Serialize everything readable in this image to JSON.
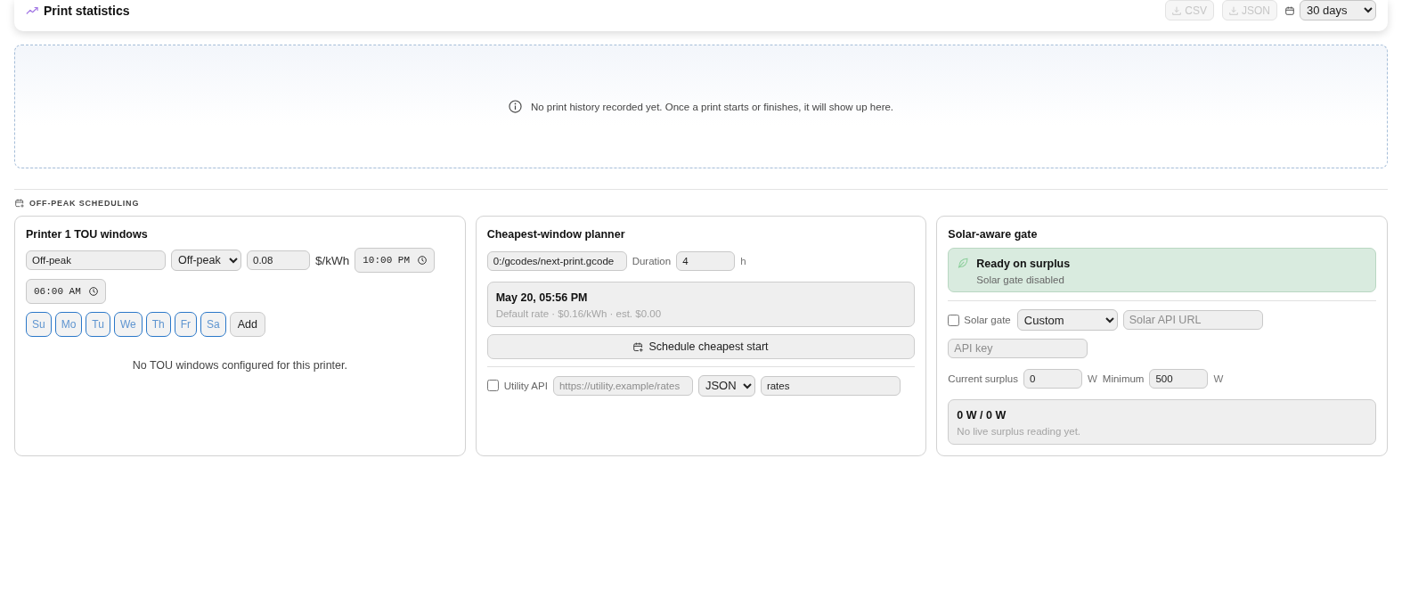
{
  "stats": {
    "title": "Print statistics",
    "exports": [
      {
        "label": "CSV",
        "disabled": true
      },
      {
        "label": "JSON",
        "disabled": true
      }
    ],
    "range": "30 days",
    "empty_message": "No print history recorded yet. Once a print starts or finishes, it will show up here."
  },
  "section_title": "OFF-PEAK SCHEDULING",
  "tou_card": {
    "title": "Printer 1 TOU windows",
    "name": "Off-peak",
    "tier": "Off-peak",
    "rate": "0.08",
    "rate_unit": "$/kWh",
    "start_time": "10:00 PM",
    "end_time": "06:00 AM",
    "days": [
      {
        "label": "Su",
        "selected": false
      },
      {
        "label": "Mo",
        "selected": false
      },
      {
        "label": "Tu",
        "selected": false
      },
      {
        "label": "We",
        "selected": false
      },
      {
        "label": "Th",
        "selected": false
      },
      {
        "label": "Fr",
        "selected": false
      },
      {
        "label": "Sa",
        "selected": false
      }
    ],
    "add_button": "Add",
    "empty_message": "No TOU windows configured for this printer."
  },
  "planner_card": {
    "title": "Cheapest-window planner",
    "file": "0:/gcodes/next-print.gcode",
    "duration_label": "Duration",
    "duration": "4",
    "duration_unit": "h",
    "result": {
      "time": "May 20, 05:56 PM",
      "detail": "Default rate · $0.16/kWh · est. $0.00"
    },
    "schedule_button": "Schedule cheapest start",
    "utility_api": {
      "label": "Utility API",
      "checked": false,
      "url_placeholder": "https://utility.example/rates",
      "format": "JSON",
      "path": "rates"
    }
  },
  "solar_card": {
    "title": "Solar-aware gate",
    "status": {
      "title": "Ready on surplus",
      "detail": "Solar gate disabled"
    },
    "gate": {
      "label": "Solar gate",
      "checked": false
    },
    "provider": "Custom",
    "url_placeholder": "Solar API URL",
    "key_placeholder": "API key",
    "surplus_label": "Current surplus",
    "surplus": "0",
    "surplus_unit": "W",
    "minimum_label": "Minimum",
    "minimum": "500",
    "minimum_unit": "W",
    "reading": {
      "title": "0 W / 0 W",
      "detail": "No live surplus reading yet."
    }
  }
}
